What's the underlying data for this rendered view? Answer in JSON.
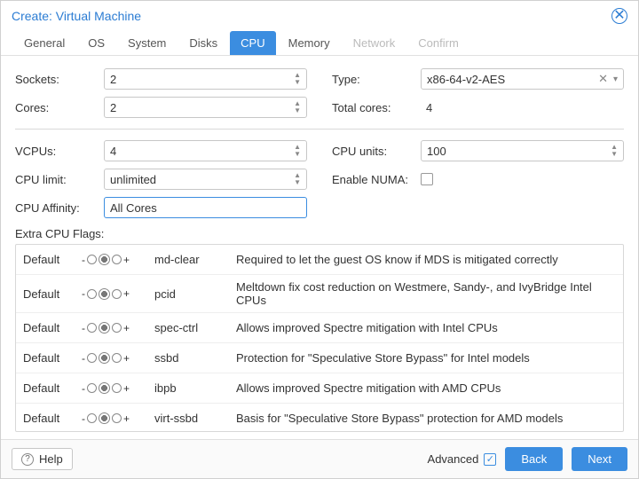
{
  "title": "Create: Virtual Machine",
  "tabs": [
    {
      "label": "General",
      "state": "normal"
    },
    {
      "label": "OS",
      "state": "normal"
    },
    {
      "label": "System",
      "state": "normal"
    },
    {
      "label": "Disks",
      "state": "normal"
    },
    {
      "label": "CPU",
      "state": "active"
    },
    {
      "label": "Memory",
      "state": "normal"
    },
    {
      "label": "Network",
      "state": "disabled"
    },
    {
      "label": "Confirm",
      "state": "disabled"
    }
  ],
  "left": {
    "sockets_label": "Sockets:",
    "sockets": "2",
    "cores_label": "Cores:",
    "cores": "2",
    "vcpus_label": "VCPUs:",
    "vcpus": "4",
    "cpu_limit_label": "CPU limit:",
    "cpu_limit": "unlimited",
    "cpu_affinity_label": "CPU Affinity:",
    "cpu_affinity": "All Cores"
  },
  "right": {
    "type_label": "Type:",
    "type": "x86-64-v2-AES",
    "total_cores_label": "Total cores:",
    "total_cores": "4",
    "cpu_units_label": "CPU units:",
    "cpu_units": "100",
    "numa_label": "Enable NUMA:"
  },
  "flags_label": "Extra CPU Flags:",
  "flags": [
    {
      "state": "Default",
      "name": "md-clear",
      "desc": "Required to let the guest OS know if MDS is mitigated correctly"
    },
    {
      "state": "Default",
      "name": "pcid",
      "desc": "Meltdown fix cost reduction on Westmere, Sandy-, and IvyBridge Intel CPUs"
    },
    {
      "state": "Default",
      "name": "spec-ctrl",
      "desc": "Allows improved Spectre mitigation with Intel CPUs"
    },
    {
      "state": "Default",
      "name": "ssbd",
      "desc": "Protection for \"Speculative Store Bypass\" for Intel models"
    },
    {
      "state": "Default",
      "name": "ibpb",
      "desc": "Allows improved Spectre mitigation with AMD CPUs"
    },
    {
      "state": "Default",
      "name": "virt-ssbd",
      "desc": "Basis for \"Speculative Store Bypass\" protection for AMD models"
    }
  ],
  "footer": {
    "help": "Help",
    "advanced": "Advanced",
    "back": "Back",
    "next": "Next"
  }
}
